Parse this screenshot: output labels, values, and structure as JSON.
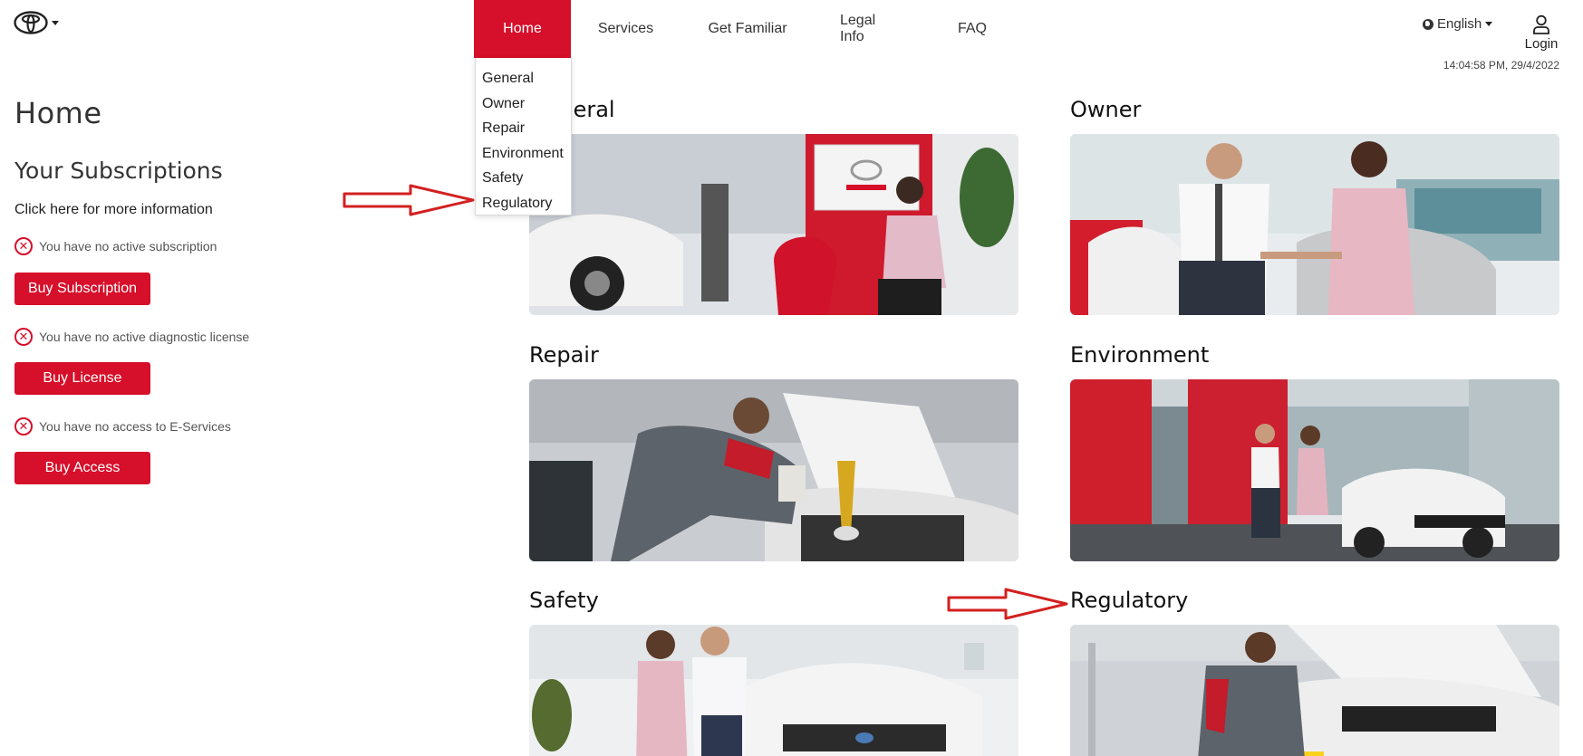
{
  "header": {
    "logo_icon": "toyota-logo-icon",
    "nav": [
      {
        "label": "Home",
        "active": true
      },
      {
        "label": "Services"
      },
      {
        "label": "Get Familiar"
      },
      {
        "label": "Legal Info"
      },
      {
        "label": "FAQ"
      }
    ],
    "dropdown": [
      "General",
      "Owner",
      "Repair",
      "Environment",
      "Safety",
      "Regulatory"
    ],
    "language": "English",
    "login_label": "Login",
    "timestamp": "14:04:58 PM, 29/4/2022"
  },
  "sidebar": {
    "page_title": "Home",
    "subscriptions_title": "Your Subscriptions",
    "more_info": "Click here for more information",
    "status_subscription": "You have no active subscription",
    "buy_subscription": "Buy Subscription",
    "status_license": "You have no active diagnostic license",
    "buy_license": "Buy License",
    "status_access": "You have no access to E-Services",
    "buy_access": "Buy Access"
  },
  "cards": {
    "general": "General",
    "owner": "Owner",
    "repair": "Repair",
    "environment": "Environment",
    "safety": "Safety",
    "regulatory": "Regulatory"
  },
  "colors": {
    "accent": "#d60f2a",
    "annotation_arrow": "#d32020"
  }
}
